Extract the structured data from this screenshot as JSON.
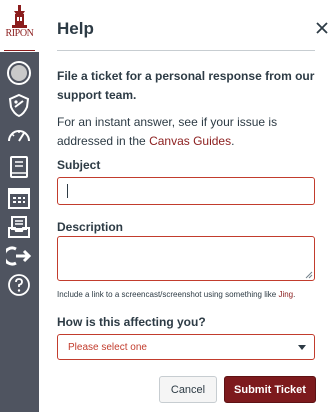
{
  "brand": {
    "name": "RIPON",
    "sub": "COLLEGE",
    "color": "#8b1d1d"
  },
  "nav": {
    "items": [
      {
        "icon": "account-avatar-icon"
      },
      {
        "icon": "admin-shield-icon"
      },
      {
        "icon": "dashboard-gauge-icon"
      },
      {
        "icon": "courses-book-icon"
      },
      {
        "icon": "calendar-icon"
      },
      {
        "icon": "inbox-icon"
      },
      {
        "icon": "logout-arrow-icon"
      },
      {
        "icon": "help-question-icon"
      }
    ]
  },
  "tray": {
    "title": "Help",
    "lead": "File a ticket for a personal response from our support team.",
    "hint_prefix": "For an instant answer, see if your issue is addressed in the ",
    "hint_link": "Canvas Guides",
    "hint_suffix": ".",
    "subject_label": "Subject",
    "subject_value": "",
    "description_label": "Description",
    "description_value": "",
    "note_prefix": "Include a link to a screencast/screenshot using something like ",
    "note_link": "Jing",
    "note_suffix": ".",
    "impact_label": "How is this affecting you?",
    "impact_selected": "Please select one",
    "cancel_label": "Cancel",
    "submit_label": "Submit Ticket"
  },
  "colors": {
    "nav_bg": "#4f5460",
    "accent": "#8b1d1d",
    "error_border": "#c23c2d",
    "submit_bg": "#7d1a1d"
  }
}
